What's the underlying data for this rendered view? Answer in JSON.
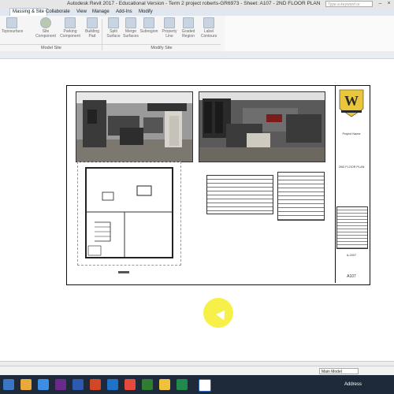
{
  "window": {
    "title": "Autodesk Revit 2017 - Educational Version -  Term 2 project roberts-GR6973 - Sheet: A107 - 2ND FLOOR PLAN",
    "search_placeholder": "Type a keyword or phrase"
  },
  "tabs": [
    "Massing & Site",
    "Collaborate",
    "View",
    "Manage",
    "Add-Ins",
    "Modify"
  ],
  "active_tab": "Massing & Site",
  "ribbon": {
    "buttons": [
      "Toposurface",
      "Site Component",
      "Parking Component",
      "Building Pad",
      "Split Surface",
      "Merge Surfaces",
      "Subregion",
      "Property Line",
      "Graded Region",
      "Label Contours"
    ],
    "panels": [
      "Model Site",
      "Modify Site"
    ]
  },
  "sheet": {
    "project_name": "Project Name",
    "view_title": "2ND FLOOR PLAN",
    "sheet_number": "A107",
    "sheet_id": "A-2007"
  },
  "statusbar": {
    "model": "Main Model"
  },
  "taskbar": {
    "address_label": "Address"
  }
}
